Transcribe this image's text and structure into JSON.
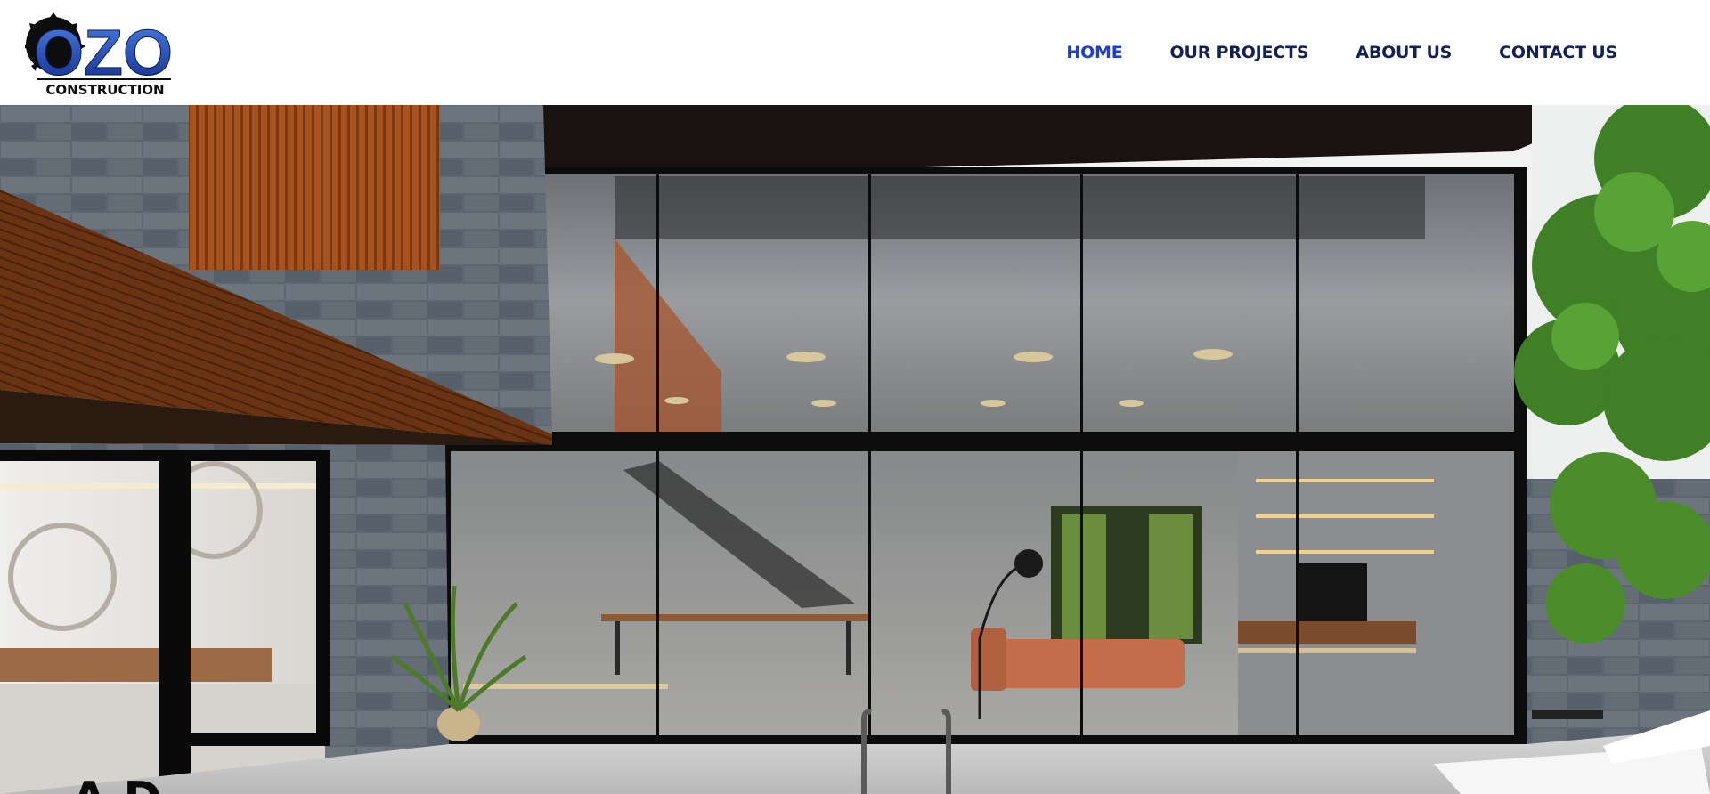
{
  "brand": {
    "logo_word": "OZO",
    "logo_sub": "CONSTRUCTION",
    "colors": {
      "blue_light": "#4a7fe0",
      "blue_dark": "#122a8a",
      "ink": "#0d0d0d"
    }
  },
  "nav": {
    "items": [
      {
        "label": "HOME",
        "active": true
      },
      {
        "label": "OUR PROJECTS",
        "active": false
      },
      {
        "label": "ABOUT US",
        "active": false
      },
      {
        "label": "CONTACT US",
        "active": false
      }
    ],
    "colors": {
      "active": "#1d3fd6",
      "default": "#132158"
    }
  },
  "hero": {
    "image": "modern-house-glass-facade-render",
    "heading_partial": "A   D  "
  }
}
